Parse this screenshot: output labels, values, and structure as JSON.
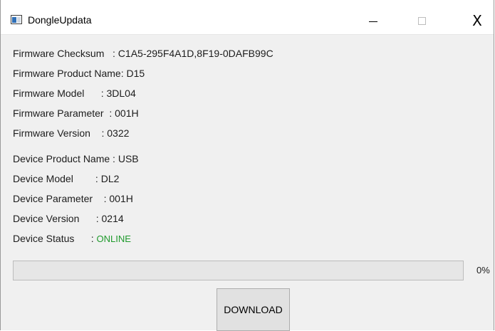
{
  "window": {
    "title": "DongleUpdata",
    "controls": {
      "minimize": "—",
      "close": "X"
    }
  },
  "firmware": [
    "Firmware Checksum   : C1A5-295F4A1D,8F19-0DAFB99C",
    "Firmware Product Name: D15",
    "Firmware Model      : 3DL04",
    "Firmware Parameter  : 001H",
    "Firmware Version    : 0322"
  ],
  "device": [
    "Device Product Name : USB",
    "Device Model        : DL2",
    "Device Parameter    : 001H",
    "Device Version      : 0214"
  ],
  "device_status": {
    "label": "Device Status      : ",
    "value": "ONLINE",
    "color": "#1f9a2c"
  },
  "progress": {
    "value": 0,
    "label": "0%"
  },
  "buttons": {
    "download": "DOWNLOAD"
  }
}
